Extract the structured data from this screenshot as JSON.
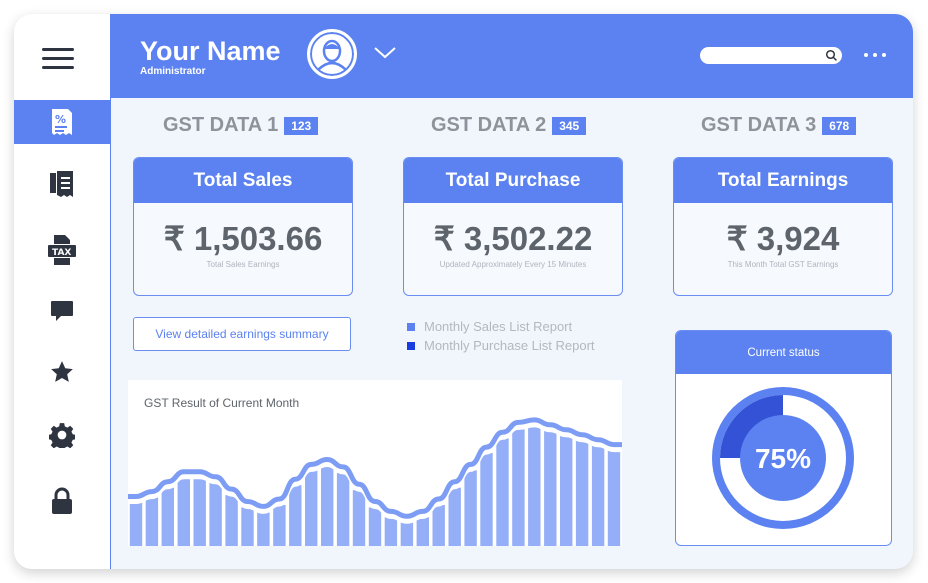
{
  "header": {
    "user_name": "Your Name",
    "user_role": "Administrator",
    "search_placeholder": ""
  },
  "sidebar": {
    "items": [
      {
        "icon": "receipt-percent-icon",
        "active": true
      },
      {
        "icon": "receipt-list-icon",
        "active": false
      },
      {
        "icon": "tax-document-icon",
        "label": "TAX",
        "active": false
      },
      {
        "icon": "chat-icon",
        "active": false
      },
      {
        "icon": "star-icon",
        "active": false
      },
      {
        "icon": "gear-icon",
        "active": false
      },
      {
        "icon": "lock-icon",
        "active": false
      }
    ]
  },
  "gst": [
    {
      "label": "GST DATA 1",
      "badge": "123"
    },
    {
      "label": "GST DATA 2",
      "badge": "345"
    },
    {
      "label": "GST DATA 3",
      "badge": "678"
    }
  ],
  "cards": [
    {
      "title": "Total Sales",
      "value": "₹ 1,503.66",
      "sub": "Total Sales Earnings"
    },
    {
      "title": "Total Purchase",
      "value": "₹ 3,502.22",
      "sub": "Updated Approximately Every 15 Minutes"
    },
    {
      "title": "Total Earnings",
      "value": "₹ 3,924",
      "sub": "This Month Total GST Earnings"
    }
  ],
  "view_button": "View detailed earnings summary",
  "legend": [
    {
      "label": "Monthly Sales List Report",
      "color": "#5b82f0"
    },
    {
      "label": "Monthly Purchase List Report",
      "color": "#1a3de0"
    }
  ],
  "chart_data": {
    "type": "area",
    "title": "GST Result of Current Month",
    "xlabel": "",
    "ylabel": "",
    "grid": false,
    "values": [
      40,
      44,
      52,
      60,
      60,
      56,
      46,
      36,
      32,
      38,
      54,
      66,
      70,
      64,
      50,
      36,
      28,
      24,
      28,
      38,
      52,
      66,
      80,
      92,
      100,
      102,
      98,
      94,
      90,
      86,
      82
    ]
  },
  "status": {
    "title": "Current status",
    "percent_label": "75%",
    "percent": 75
  },
  "colors": {
    "accent": "#5b82f0",
    "dark_accent": "#3452d6",
    "chart_bar": "#94aff7",
    "background": "#f1f6fd"
  }
}
